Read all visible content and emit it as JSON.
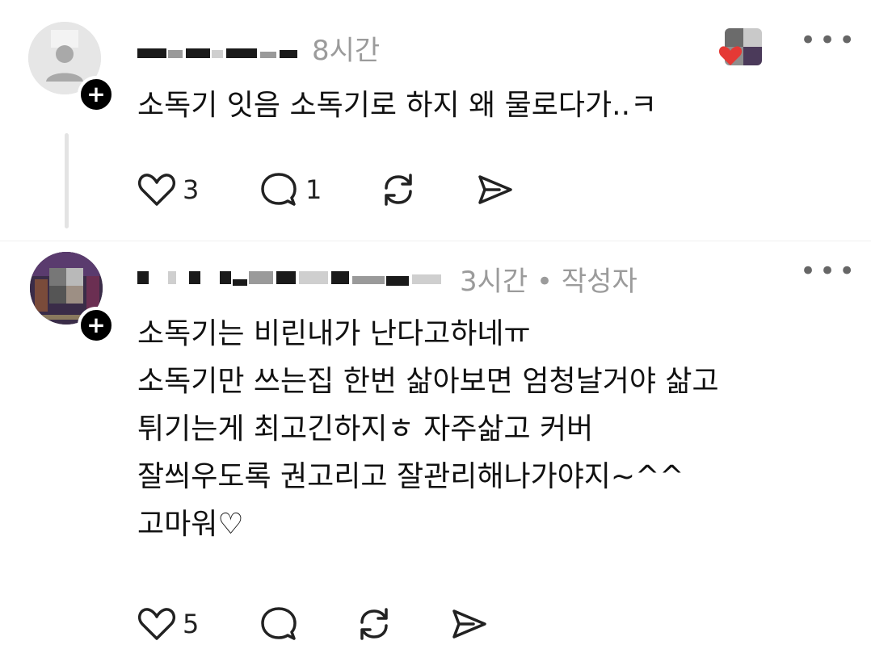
{
  "posts": [
    {
      "time": "8시간",
      "author_tag": "",
      "text": [
        "소독기 잇음 소독기로 하지 왜 물로다가..ㅋ"
      ],
      "likes": "3",
      "replies": "1"
    },
    {
      "time": "3시간",
      "author_tag": "작성자",
      "text": [
        "소독기는 비린내가 난다고하네ㅠ",
        "소독기만 쓰는집 한번 삶아보면 엄청날거야 삶고",
        "튀기는게 최고긴하지ㅎ 자주삶고 커버",
        "잘씌우도록 권고리고 잘관리해나가야지~^^",
        "고마워♡"
      ],
      "likes": "5",
      "replies": ""
    }
  ],
  "separator": "•",
  "colors": {
    "accent_like": "#e53935",
    "meta_gray": "#9b9b9b",
    "badge": "#000000"
  },
  "icons": [
    "heart-icon",
    "comment-icon",
    "repost-icon",
    "share-icon",
    "more-icon",
    "plus-icon"
  ]
}
